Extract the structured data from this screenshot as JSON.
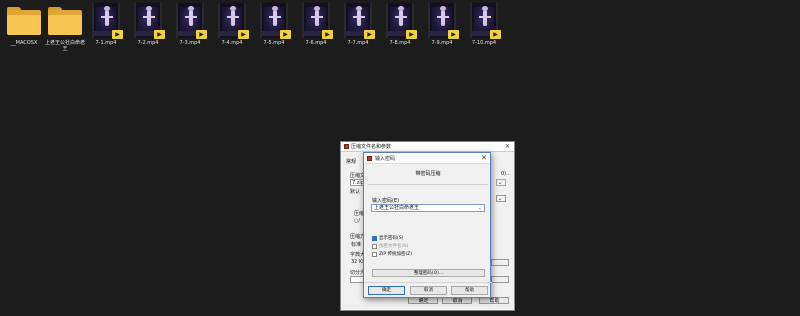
{
  "desktop": {
    "items": [
      {
        "name": "__MACOSX",
        "type": "folder"
      },
      {
        "name": "上老王公社白命老王",
        "type": "folder"
      },
      {
        "name": "7-1.mp4",
        "type": "video"
      },
      {
        "name": "7-2.mp4",
        "type": "video"
      },
      {
        "name": "7-3.mp4",
        "type": "video"
      },
      {
        "name": "7-4.mp4",
        "type": "video"
      },
      {
        "name": "7-5.mp4",
        "type": "video"
      },
      {
        "name": "7-6.mp4",
        "type": "video"
      },
      {
        "name": "7-7.mp4",
        "type": "video"
      },
      {
        "name": "7-8.mp4",
        "type": "video"
      },
      {
        "name": "7-9.mp4",
        "type": "video"
      },
      {
        "name": "7-10.mp4",
        "type": "video"
      }
    ]
  },
  "bg_dialog": {
    "title": "压缩文件名和参数",
    "tab_general": "常规",
    "label_archive": "压缩文",
    "archive_value": "7.zip",
    "label_default": "默认",
    "label_method": "压缩",
    "label_update": "压缩方",
    "update_value": "标准",
    "label_dict": "字典大",
    "dict_value": "32 KB",
    "label_split": "切分为",
    "ok_label": "确定",
    "cancel_label": "取消",
    "help_label": "帮助"
  },
  "password_dialog": {
    "title": "输入密码",
    "heading": "带密码压缩",
    "password_label": "输入密码(E)",
    "password_value": "上老王公社白命老王",
    "show_password_label": "显示密码(S)",
    "encrypt_names_label": "加密文件名(N)",
    "zip_legacy_label": "ZIP 传统加密(Z)",
    "manage_label": "整理密码(O)...",
    "ok_label": "确定",
    "cancel_label": "取消",
    "help_label": "帮助"
  },
  "colors": {
    "desktop_bg": "#1c1c1c",
    "folder": "#f6c552",
    "accent": "#2f6fc4"
  }
}
